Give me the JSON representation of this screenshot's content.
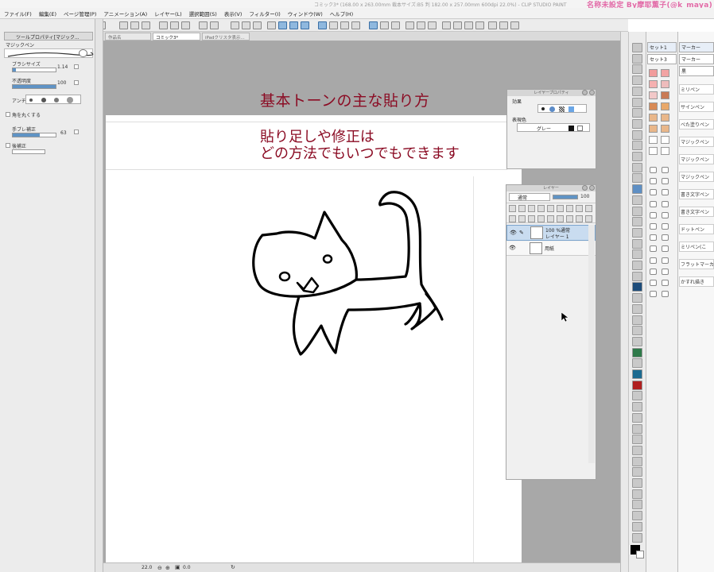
{
  "window": {
    "title": "コミック3* (168.00 x 263.00mm 裁本サイズ:B5 判 182.00 x 257.00mm 600dpi 22.0%) - CLIP STUDIO PAINT",
    "watermark": "名称未設定 By摩耶薫子(@k_maya)"
  },
  "menu": {
    "items": [
      "ファイル(F)",
      "編集(E)",
      "ページ管理(P)",
      "アニメーション(A)",
      "レイヤー(L)",
      "選択範囲(S)",
      "表示(V)",
      "フィルター(I)",
      "ウィンドウ(W)",
      "ヘルプ(H)"
    ]
  },
  "tool_property": {
    "header": "ツールプロパティ[マジック...",
    "tool_name": "マジックペン",
    "brush_size_label": "ブラシサイズ",
    "brush_size_value": "1.14",
    "opacity_label": "不透明度",
    "opacity_value": "100",
    "anti_alias_label": "アンチ",
    "round_corners_label": "角を丸くする",
    "stabilization_label": "手ブレ補正",
    "stabilization_value": "63",
    "post_correction_label": "後補正"
  },
  "tabs": [
    {
      "label": "作品名"
    },
    {
      "label": "コミック3*"
    },
    {
      "label": "iPadクリスタ表示..."
    }
  ],
  "canvas": {
    "title_text": "基本トーンの主な貼り方",
    "body_line1": "貼り足しや修正は",
    "body_line2": "どの方法でもいつでもできます"
  },
  "layer_property": {
    "title": "レイヤープロパティ",
    "effect_label": "効果",
    "expression_color_label": "表現色",
    "expression_color_value": "グレー"
  },
  "layers": {
    "title": "レイヤー",
    "blend_mode": "通常",
    "opacity": "100",
    "items": [
      {
        "line1": "100 %通常",
        "line2": "レイヤー 1"
      },
      {
        "line1": "",
        "line2": "用紙"
      }
    ]
  },
  "sub_tool": {
    "sets": [
      "セット1",
      "セット3"
    ],
    "category": "マーカー",
    "category2": "マーカー",
    "group": "黒",
    "brushes": [
      "ミリペン",
      "サインペン",
      "べた塗りペン",
      "マジックペン",
      "マジックペン",
      "マジックペン",
      "書き文字ペン",
      "書き文字ペン",
      "ドットペン",
      "ミリペン(こ",
      "フラットマーカ",
      "かすれ描き"
    ]
  },
  "status": {
    "zoom": "22.0",
    "angle": "0.0"
  },
  "colors": {
    "accent_red": "#8b0c24",
    "selection_blue": "#5f93c5"
  }
}
